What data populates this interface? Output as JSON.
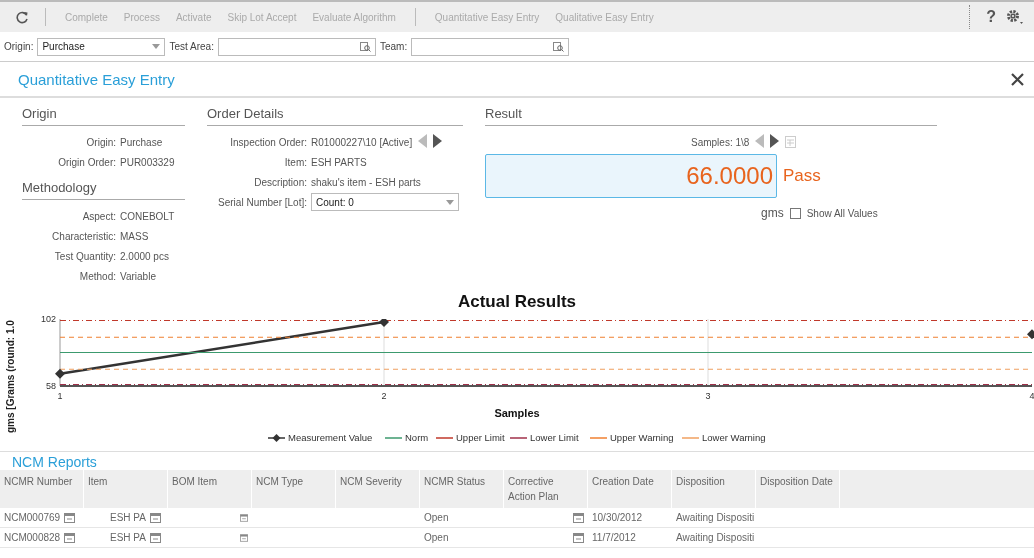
{
  "toolbar": {
    "groups": [
      [
        "Complete",
        "Process",
        "Activate",
        "Skip Lot Accept",
        "Evaluate Algorithm"
      ],
      [
        "Quantitative Easy Entry",
        "Qualitative Easy Entry"
      ]
    ],
    "help": "?"
  },
  "filters": [
    {
      "label": "Origin:",
      "value": "Purchase",
      "kind": "select"
    },
    {
      "label": "Test Area:",
      "kind": "lookup"
    },
    {
      "label": "Team:",
      "kind": "lookup"
    }
  ],
  "panel": {
    "title": "Quantitative Easy Entry"
  },
  "origin": {
    "title": "Origin",
    "fields": [
      {
        "label": "Origin:",
        "value": "Purchase"
      },
      {
        "label": "Origin Order:",
        "value": "PUR003329"
      }
    ]
  },
  "methodology": {
    "title": "Methodology",
    "fields": [
      {
        "label": "Aspect:",
        "value": "CONEBOLT"
      },
      {
        "label": "Characteristic:",
        "value": "MASS"
      },
      {
        "label": "Test Quantity:",
        "value": "2.0000 pcs"
      },
      {
        "label": "Method:",
        "value": "Variable"
      }
    ]
  },
  "order_details": {
    "title": "Order Details",
    "inspection_order": {
      "label": "Inspection Order:",
      "value": "R01000227\\10 [Active]",
      "prev_enabled": false,
      "next_enabled": true
    },
    "fields": [
      {
        "label": "Item:",
        "value": "ESH PARTS"
      },
      {
        "label": "Description:",
        "value": "shaku's item - ESH parts"
      }
    ],
    "serial": {
      "label": "Serial Number [Lot]:",
      "value": "Count: 0"
    }
  },
  "result": {
    "title": "Result",
    "samples": "Samples: 1\\8",
    "prev_enabled": false,
    "next_enabled": true,
    "value": "66.0000",
    "verdict": "Pass",
    "unit": "gms",
    "show_all": {
      "label": "Show All Values",
      "checked": false
    }
  },
  "chart": {
    "chart_data": {
      "type": "line",
      "title": "Actual Results",
      "xlabel": "Samples",
      "ylabel": "gms [Grams (round: 1.0",
      "x": [
        1,
        2,
        3,
        4
      ],
      "xlim": [
        1,
        4
      ],
      "ylim": [
        58,
        102
      ],
      "xticks": [
        1,
        2,
        3,
        4
      ],
      "yticks": [
        58,
        102
      ],
      "legend": true,
      "series": [
        {
          "name": "Measurement Value",
          "color": "#333333",
          "line_style": "solid",
          "marker": "diamond",
          "values": [
            66,
            100,
            null,
            92
          ]
        },
        {
          "name": "Norm",
          "color": "#3c9a6e",
          "line_style": "solid",
          "values": [
            80,
            80,
            80,
            80
          ]
        },
        {
          "name": "Upper Limit",
          "color": "#c0392b",
          "line_style": "dash-dot",
          "values": [
            101,
            101,
            101,
            101
          ]
        },
        {
          "name": "Lower Limit",
          "color": "#a0304a",
          "line_style": "dash-dot",
          "values": [
            59,
            59,
            59,
            59
          ]
        },
        {
          "name": "Upper Warning",
          "color": "#f08030",
          "line_style": "dashed",
          "values": [
            90,
            90,
            90,
            90
          ]
        },
        {
          "name": "Lower Warning",
          "color": "#f0a060",
          "line_style": "dashed",
          "values": [
            69,
            69,
            69,
            69
          ]
        }
      ]
    }
  },
  "ncm": {
    "title": "NCM Reports",
    "columns": [
      "NCMR Number",
      "Item",
      "BOM Item",
      "NCM Type",
      "NCM Severity",
      "NCMR Status",
      "Corrective Action Plan",
      "Creation Date",
      "Disposition",
      "Disposition Date"
    ],
    "rows": [
      {
        "number": "NCM000769",
        "item": "ESH PA",
        "status": "Open",
        "creation_date": "10/30/2012",
        "disposition": "Awaiting Dispositi"
      },
      {
        "number": "NCM000828",
        "item": "ESH PA",
        "status": "Open",
        "creation_date": "11/7/2012",
        "disposition": "Awaiting Dispositi"
      }
    ]
  }
}
